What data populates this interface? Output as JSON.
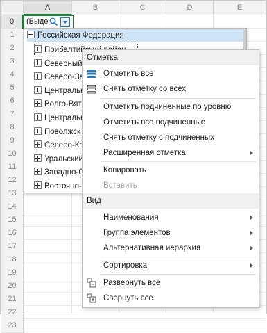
{
  "sheet": {
    "columns": [
      "A",
      "B",
      "C",
      "D",
      "E"
    ],
    "rows": [
      "0",
      "1",
      "2",
      "3",
      "4",
      "5",
      "6",
      "7",
      "8",
      "9",
      "10",
      "11",
      "12",
      "13",
      "14",
      "15",
      "16",
      "17",
      "18",
      "19",
      "20",
      "21",
      "22",
      "23"
    ],
    "cell_a0_value": "(Выде"
  },
  "tree": {
    "root": "Российская Федерация",
    "children": [
      "Прибалтийский район",
      "Северный",
      "Северо-За",
      "Центральн",
      "Волго-Вят",
      "Центральн",
      "Поволжск",
      "Северо-Ка",
      "Уральский",
      "Западно-С",
      "Восточно-"
    ]
  },
  "menu": {
    "section_mark": "Отметка",
    "mark_all": "Отметить все",
    "unmark_all": "Снять отметку со всех",
    "mark_children_level": "Отметить подчиненные по уровню",
    "mark_all_children": "Отметить все подчиненные",
    "unmark_children": "Снять отметку с подчиненных",
    "extended_mark": "Расширенная отметка",
    "copy": "Копировать",
    "paste": "Вставить",
    "section_view": "Вид",
    "names": "Наименования",
    "element_group": "Группа элементов",
    "alt_hierarchy": "Альтернативная иерархия",
    "sorting": "Сортировка",
    "expand_all": "Развернуть все",
    "collapse_all": "Свернуть все"
  },
  "icons": {
    "mark_all": "stacked-blue-bars-icon",
    "unmark_all": "stacked-outline-bars-icon",
    "expand_all": "expand-tree-icon",
    "collapse_all": "collapse-tree-icon",
    "search": "magnifier-icon",
    "dropdown": "chevron-down-icon"
  },
  "colors": {
    "accent": "#1a7f37",
    "selection": "#cfe3f6",
    "icon_blue": "#2a7ab8"
  }
}
